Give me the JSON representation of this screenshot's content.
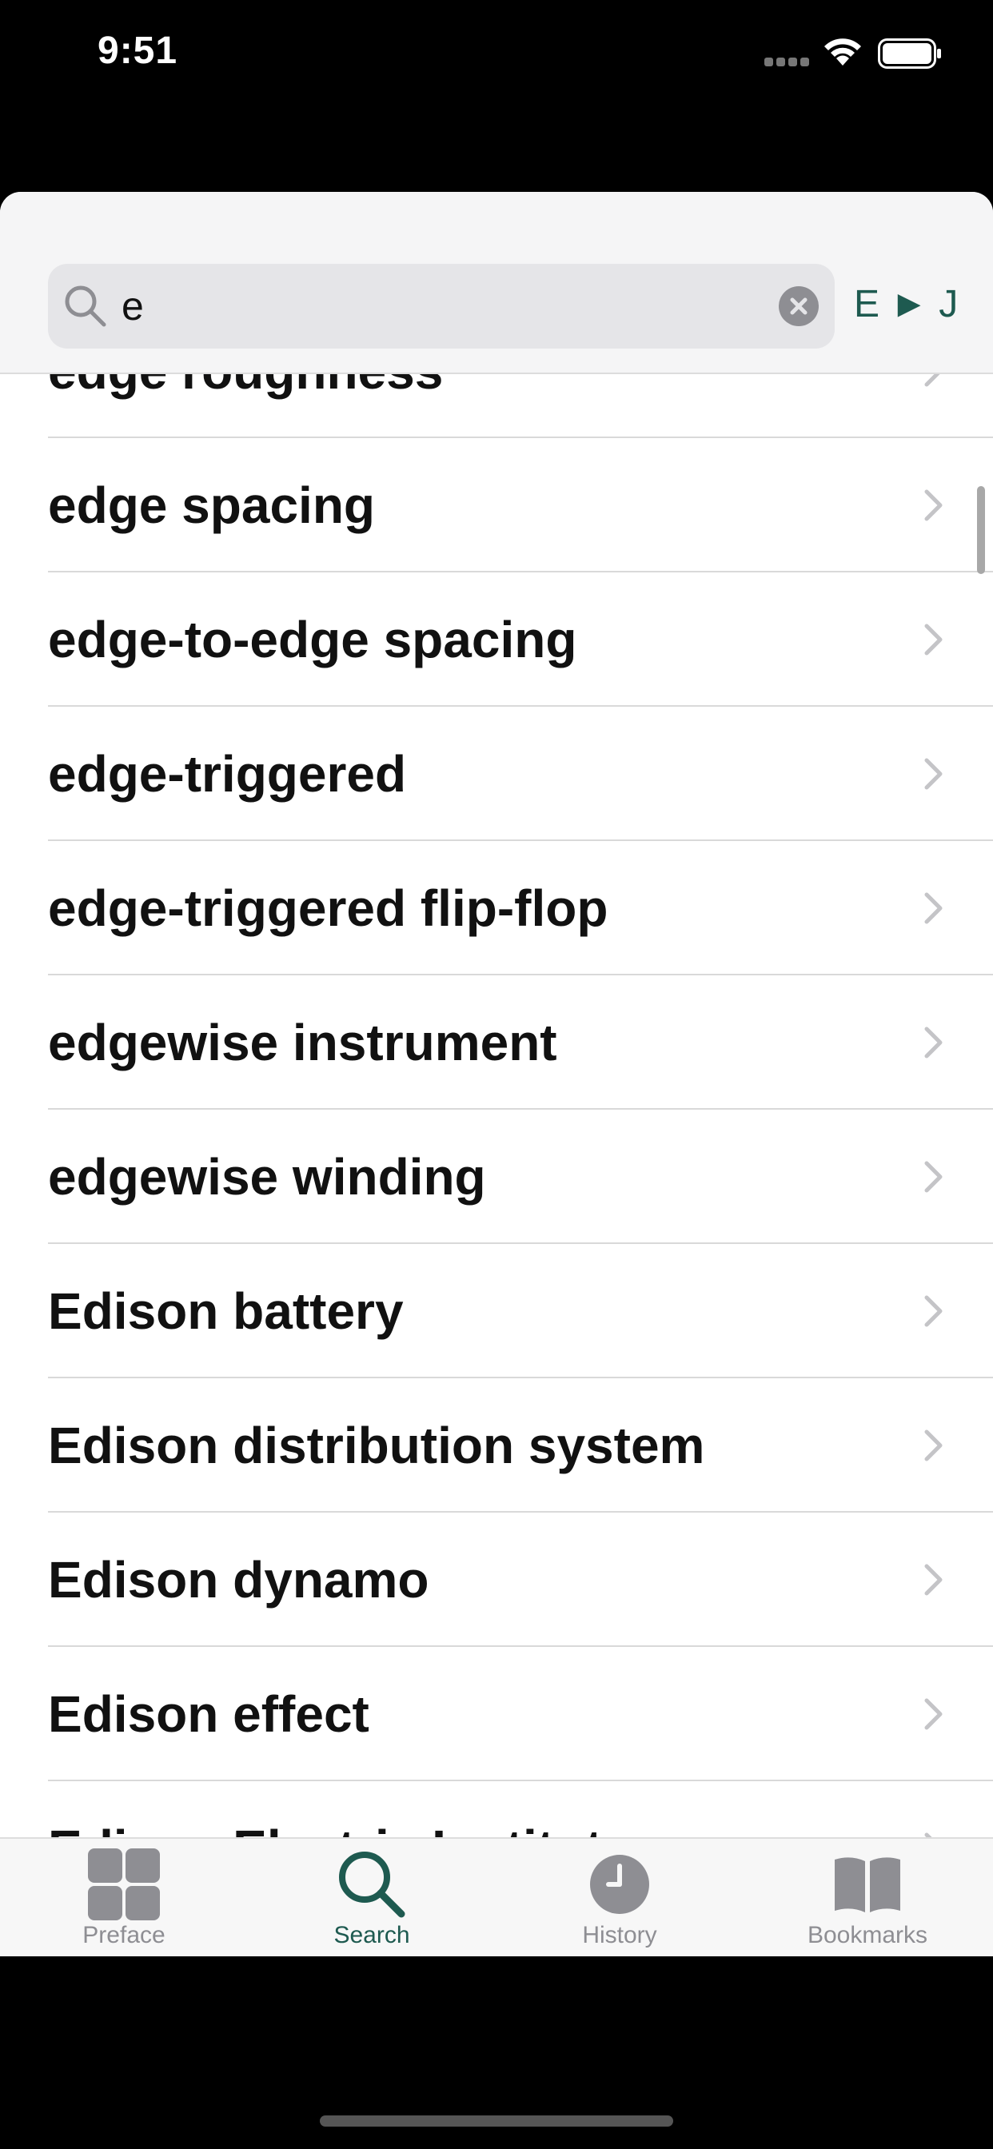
{
  "status_bar": {
    "time": "9:51"
  },
  "search": {
    "query": "e",
    "direction_label": "E ► J"
  },
  "results": [
    "edge roughness",
    "edge spacing",
    "edge-to-edge spacing",
    "edge-triggered",
    "edge-triggered flip-flop",
    "edgewise instrument",
    "edgewise winding",
    "Edison battery",
    "Edison distribution system",
    "Edison dynamo",
    "Edison effect",
    "Edison Electric Institute"
  ],
  "tabs": [
    {
      "label": "Preface",
      "icon": "grid-icon"
    },
    {
      "label": "Search",
      "icon": "search-icon"
    },
    {
      "label": "History",
      "icon": "clock-icon"
    },
    {
      "label": "Bookmarks",
      "icon": "book-icon"
    }
  ],
  "colors": {
    "accent": "#1e5a50",
    "inactive": "#8e8e93"
  }
}
